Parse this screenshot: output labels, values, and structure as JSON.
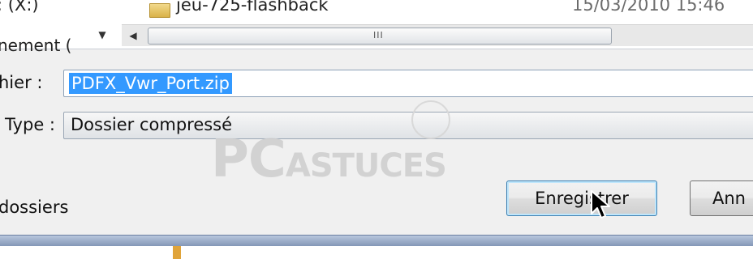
{
  "file_list": {
    "drive_label_partial": "; (X:)",
    "folder_name": "jeu-725-flashback",
    "folder_date": "15/03/2010 15:46",
    "nav_item_partial": "nement (",
    "scrollbar_grip": "III"
  },
  "form": {
    "filename_label_partial": "hier :",
    "filename_value": "PDFX_Vwr_Port.zip",
    "type_label_partial": "Type :",
    "type_value": "Dossier compressé"
  },
  "footer": {
    "folders_label_partial": "dossiers",
    "save_button": "Enregistrer",
    "cancel_button_partial": "Ann"
  },
  "watermark": {
    "logo_pc": "PC",
    "logo_astuces": "ASTUCES"
  },
  "icons": [
    "folder-icon",
    "chevron-down-icon",
    "chevron-left-icon",
    "mouse-cursor-icon",
    "lightbulb-watermark-icon"
  ]
}
